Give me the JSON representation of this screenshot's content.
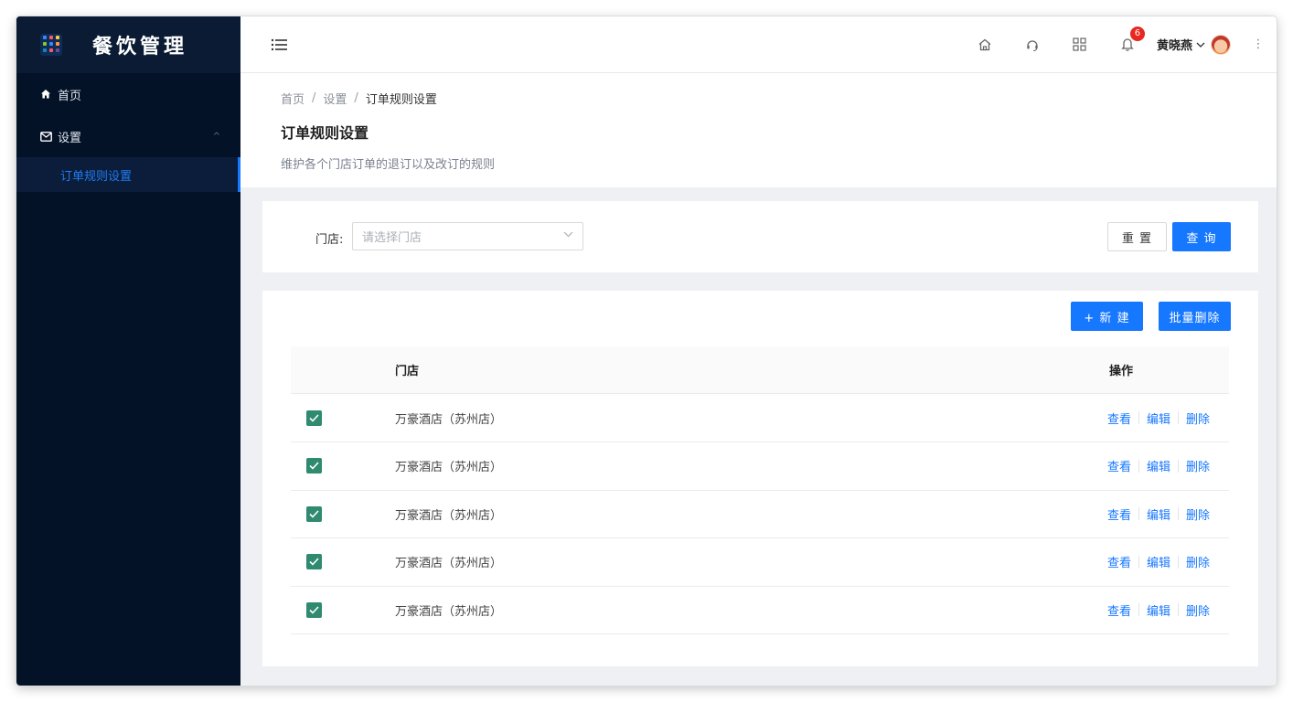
{
  "app": {
    "title": "餐饮管理",
    "brand_dot_colors": [
      "#3a86ff",
      "#ff595e",
      "#ffca3a",
      "#8ac926",
      "#3a86ff",
      "#ff924c",
      "#1982c4",
      "#ff595e",
      "#6a4c93"
    ]
  },
  "sidebar": {
    "items": [
      {
        "label": "首页",
        "icon": "home-icon"
      },
      {
        "label": "设置",
        "icon": "mail-icon",
        "expanded": true,
        "caret": "^"
      }
    ],
    "sub_items": [
      {
        "label": "订单规则设置",
        "active": true
      }
    ]
  },
  "header": {
    "icons": [
      "home-outline-icon",
      "headset-icon",
      "apps-grid-icon",
      "bell-icon"
    ],
    "notification_count": "6",
    "user_name": "黄晓燕",
    "more": "⋮"
  },
  "page": {
    "breadcrumb": [
      "首页",
      "设置",
      "订单规则设置"
    ],
    "breadcrumb_sep": "/",
    "title": "订单规则设置",
    "description": "维护各个门店订单的退订以及改订的规则"
  },
  "filter": {
    "label": "门店:",
    "placeholder": "请选择门店",
    "reset_label": "重 置",
    "query_label": "查 询"
  },
  "toolbar": {
    "new_label": "+ 新 建",
    "batch_delete_label": "批量删除"
  },
  "table": {
    "columns": [
      "门店",
      "操作"
    ],
    "rows": [
      {
        "checked": true,
        "store": "万豪酒店（苏州店）",
        "actions": [
          "查看",
          "编辑",
          "删除"
        ]
      },
      {
        "checked": true,
        "store": "万豪酒店（苏州店）",
        "actions": [
          "查看",
          "编辑",
          "删除"
        ]
      },
      {
        "checked": true,
        "store": "万豪酒店（苏州店）",
        "actions": [
          "查看",
          "编辑",
          "删除"
        ]
      },
      {
        "checked": true,
        "store": "万豪酒店（苏州店）",
        "actions": [
          "查看",
          "编辑",
          "删除"
        ]
      },
      {
        "checked": true,
        "store": "万豪酒店（苏州店）",
        "actions": [
          "查看",
          "编辑",
          "删除"
        ]
      }
    ]
  },
  "colors": {
    "sidebar_bg": "#031227",
    "primary": "#1677ff",
    "checkbox": "#2f8a6f",
    "badge": "#e8271f"
  }
}
